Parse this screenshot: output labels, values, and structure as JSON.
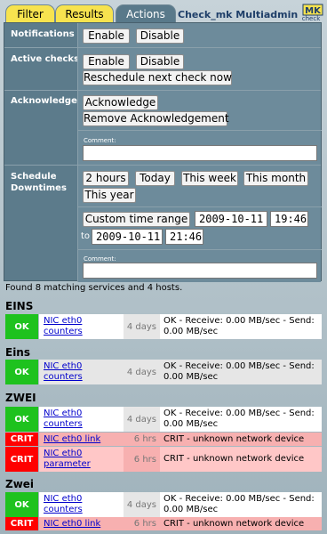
{
  "tabs": [
    {
      "label": "Filter",
      "color": "#f7e34f"
    },
    {
      "label": "Results",
      "color": "#f7e34f"
    },
    {
      "label": "Actions",
      "color": "#59798a",
      "active": true
    }
  ],
  "app_title": "Check_mk Multiadmin",
  "logo": {
    "text": "MK",
    "subtext": "check"
  },
  "actions": {
    "notifications": {
      "label": "Notifications",
      "enable": "Enable",
      "disable": "Disable"
    },
    "active_checks": {
      "label": "Active checks",
      "enable": "Enable",
      "disable": "Disable",
      "reschedule": "Reschedule next check now"
    },
    "acknowledge": {
      "label": "Acknowledge",
      "ack": "Acknowledge",
      "remove": "Remove Acknowledgement",
      "comment_label": "Comment:",
      "comment_value": ""
    },
    "downtimes": {
      "label_line1": "Schedule",
      "label_line2": "Downtimes",
      "presets": [
        "2 hours",
        "Today",
        "This week",
        "This month",
        "This year"
      ],
      "custom_button": "Custom time range",
      "from_date": "2009-10-11",
      "from_time": "19:46",
      "to_label": "to",
      "to_date": "2009-10-11",
      "to_time": "21:46",
      "comment_label": "Comment:",
      "comment_value": ""
    }
  },
  "found_text": "Found 8 matching services and 4 hosts.",
  "hosts": [
    {
      "name": "EINS",
      "services": [
        {
          "state": "OK",
          "service": "NIC eth0 counters",
          "age": "4 days",
          "output": "OK - Receive: 0.00 MB/sec - Send: 0.00 MB/sec"
        }
      ]
    },
    {
      "name": "Eins",
      "services": [
        {
          "state": "OK",
          "service": "NIC eth0 counters",
          "age": "4 days",
          "output": "OK - Receive: 0.00 MB/sec - Send: 0.00 MB/sec"
        }
      ]
    },
    {
      "name": "ZWEI",
      "services": [
        {
          "state": "OK",
          "service": "NIC eth0 counters",
          "age": "4 days",
          "output": "OK - Receive: 0.00 MB/sec - Send: 0.00 MB/sec"
        },
        {
          "state": "CRIT",
          "service": "NIC eth0 link",
          "age": "6 hrs",
          "output": "CRIT - unknown network device"
        },
        {
          "state": "CRIT",
          "service": "NIC eth0 parameter",
          "age": "6 hrs",
          "output": "CRIT - unknown network device"
        }
      ]
    },
    {
      "name": "Zwei",
      "services": [
        {
          "state": "OK",
          "service": "NIC eth0 counters",
          "age": "4 days",
          "output": "OK - Receive: 0.00 MB/sec - Send: 0.00 MB/sec"
        },
        {
          "state": "CRIT",
          "service": "NIC eth0 link",
          "age": "6 hrs",
          "output": "CRIT - unknown network device"
        }
      ]
    }
  ],
  "colors": {
    "ok": "#1ec21e",
    "crit": "#ff0000",
    "panel": "#5c7b8b",
    "link": "#0000cc"
  }
}
